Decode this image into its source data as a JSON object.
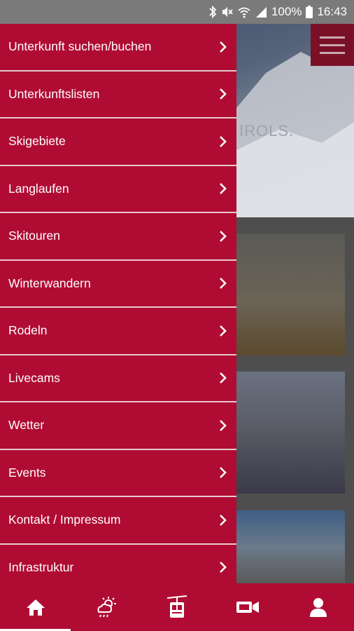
{
  "status_bar": {
    "battery": "100%",
    "time": "16:43",
    "icons": [
      "bluetooth-icon",
      "mute-icon",
      "wifi-icon",
      "signal-icon"
    ]
  },
  "background": {
    "hero_text": "IROLS."
  },
  "drawer": {
    "items": [
      {
        "label": "Unterkunft suchen/buchen"
      },
      {
        "label": "Unterkunftslisten"
      },
      {
        "label": "Skigebiete"
      },
      {
        "label": "Langlaufen"
      },
      {
        "label": "Skitouren"
      },
      {
        "label": "Winterwandern"
      },
      {
        "label": "Rodeln"
      },
      {
        "label": "Livecams"
      },
      {
        "label": "Wetter"
      },
      {
        "label": "Events"
      },
      {
        "label": "Kontakt / Impressum"
      },
      {
        "label": "Infrastruktur"
      }
    ]
  },
  "bottom_nav": {
    "items": [
      "home-icon",
      "weather-icon",
      "gondola-icon",
      "video-camera-icon",
      "profile-icon"
    ],
    "active": "home-icon"
  },
  "colors": {
    "brand": "#b00c33",
    "divider": "#e6c9cf",
    "status_bar": "#7a7a7a"
  }
}
